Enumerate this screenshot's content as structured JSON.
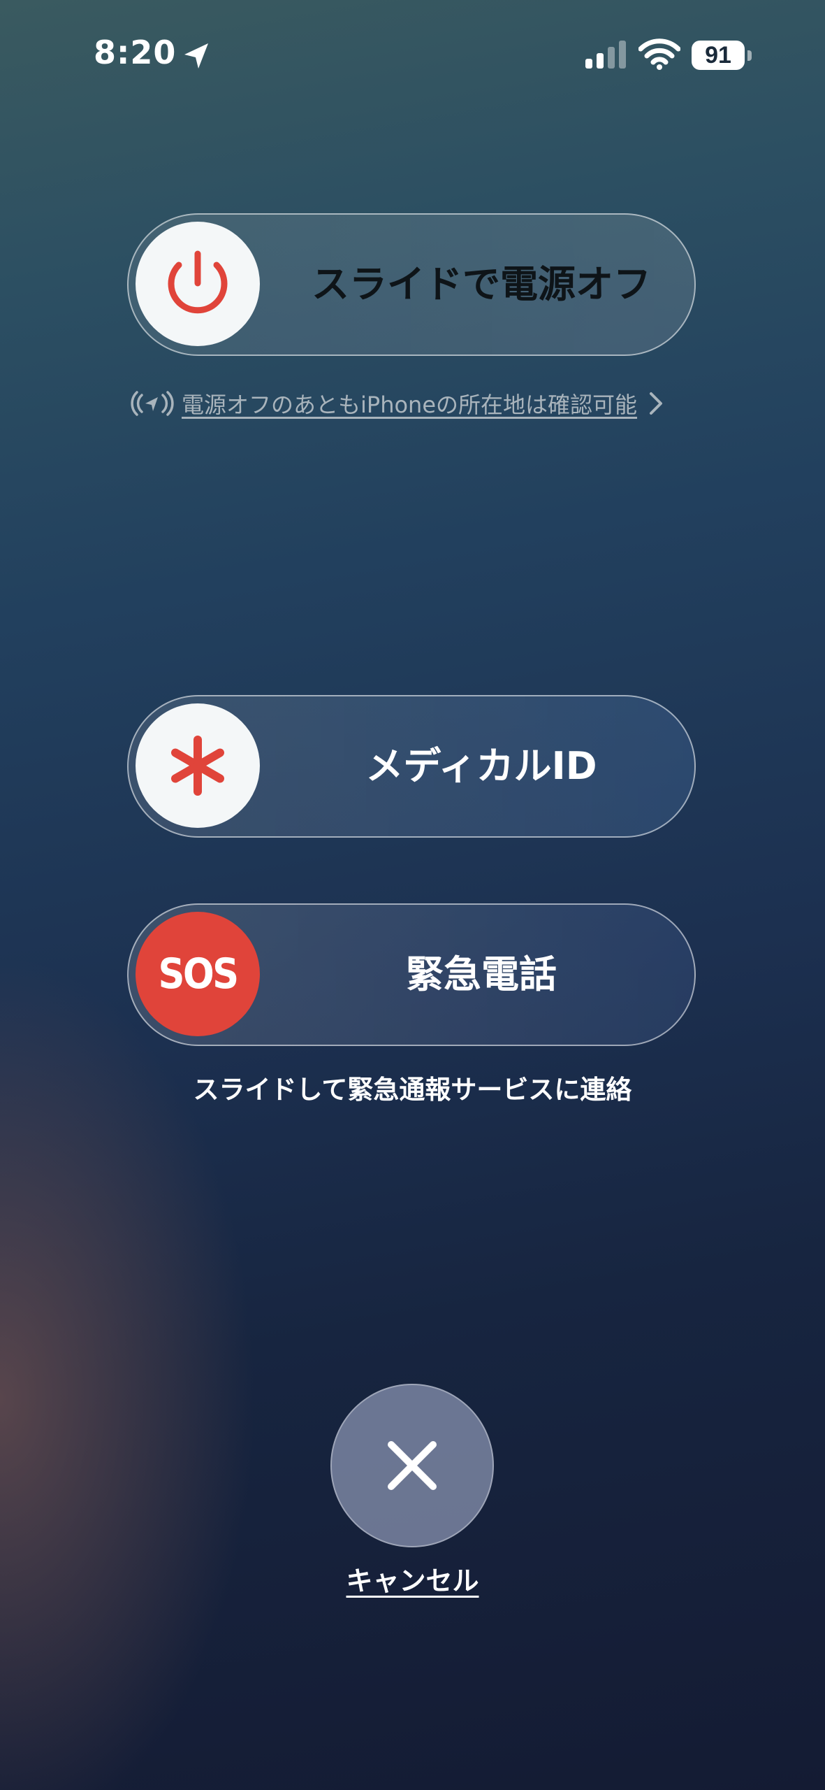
{
  "status_bar": {
    "time": "8:20",
    "battery_level": "91",
    "icons": [
      "location-arrow-icon",
      "signal-icon",
      "wifi-icon",
      "battery-icon"
    ]
  },
  "power_slider": {
    "label": "スライドで電源オフ",
    "knob_icon": "power-icon",
    "knob_icon_color": "#e0443a"
  },
  "find_my": {
    "text": "電源オフのあともiPhoneの所在地は確認可能",
    "icon": "findmy-location-icon",
    "chevron_icon": "chevron-right-icon"
  },
  "medical_id_slider": {
    "label": "メディカルID",
    "knob_icon": "asterisk-icon",
    "knob_icon_color": "#e0443a"
  },
  "sos_slider": {
    "label": "緊急電話",
    "knob_text": "SOS",
    "knob_color": "#e0443a",
    "caption": "スライドして緊急通報サービスに連絡"
  },
  "cancel": {
    "label": "キャンセル",
    "icon": "close-icon"
  }
}
